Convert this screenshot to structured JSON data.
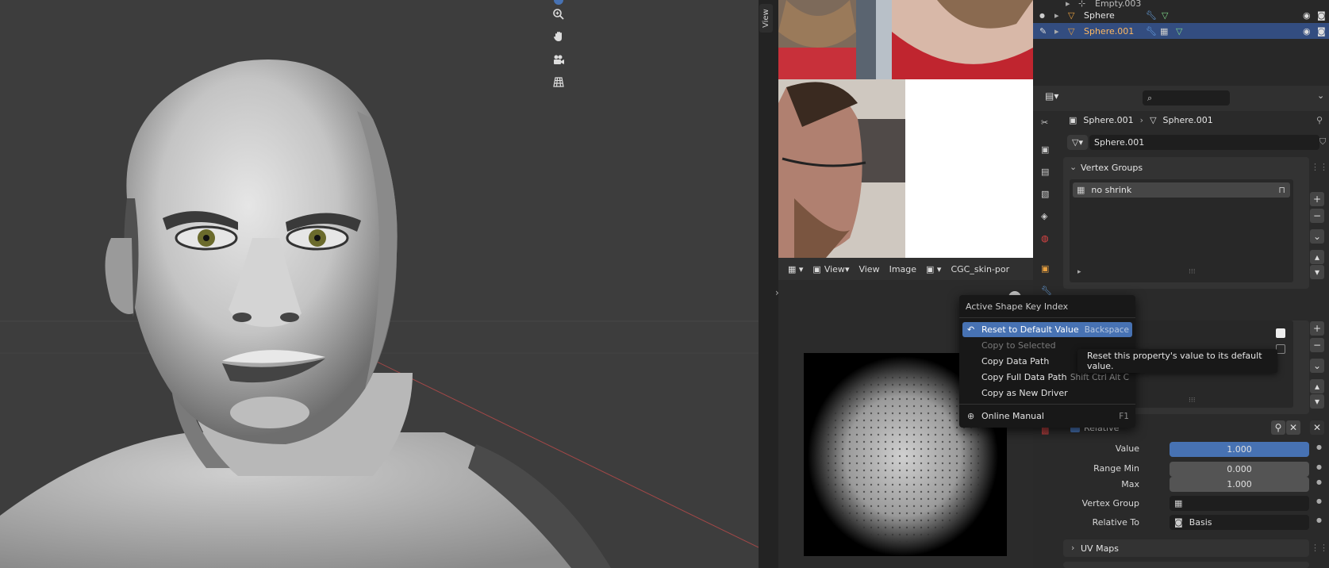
{
  "outliner": {
    "rows": [
      {
        "label": "Empty.003"
      },
      {
        "label": "Sphere"
      },
      {
        "label": "Sphere.001"
      }
    ]
  },
  "image_editor": {
    "menu_view_dropdown": "View",
    "menu_view": "View",
    "menu_image": "Image",
    "image_name": "CGC_skin-por"
  },
  "properties": {
    "breadcrumb_object": "Sphere.001",
    "breadcrumb_data": "Sphere.001",
    "mesh_name": "Sphere.001",
    "vertex_groups": {
      "title": "Vertex Groups",
      "items": [
        "no shrink"
      ]
    },
    "shape_keys": {
      "relative_label": "Relative",
      "value_label": "Value",
      "value": "1.000",
      "value_fraction": 1.0,
      "range_min_label": "Range Min",
      "range_min": "0.000",
      "max_label": "Max",
      "max": "1.000",
      "vertex_group_label": "Vertex Group",
      "relative_to_label": "Relative To",
      "relative_to": "Basis"
    },
    "uv_maps_title": "UV Maps"
  },
  "context_menu": {
    "title": "Active Shape Key Index",
    "items": [
      {
        "label": "Reset to Default Value",
        "shortcut": "Backspace"
      },
      {
        "label": "Copy to Selected",
        "shortcut": ""
      },
      {
        "label": "Copy Data Path",
        "shortcut": ""
      },
      {
        "label": "Copy Full Data Path",
        "shortcut": "Shift Ctrl Alt C"
      },
      {
        "label": "Copy as New Driver",
        "shortcut": ""
      },
      {
        "label": "Online Manual",
        "shortcut": "F1"
      }
    ]
  },
  "tooltip": "Reset this property's value to its default value.",
  "sidebar_tab": "View",
  "colors": {
    "accent_blue": "#4772b3",
    "selected_row": "#334d80",
    "object_orange": "#e8a040",
    "mesh_green": "#7fd88a"
  }
}
